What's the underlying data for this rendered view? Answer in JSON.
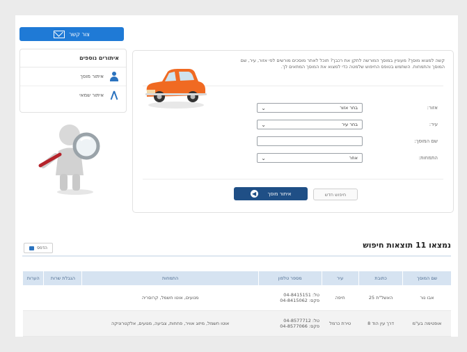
{
  "contact_button": {
    "label": "צור קשר",
    "icon": "envelope-icon"
  },
  "sidebar": {
    "title": "איתורים נוספים",
    "items": [
      {
        "label": "איתור מוסך",
        "icon": "person-icon"
      },
      {
        "label": "איתור שמאי",
        "icon": "compass-icon"
      }
    ]
  },
  "search_panel": {
    "intro": "קשה למצוא מוסך? מעוניין במוסך המורשה לתקן את רכבך? תוכל לאתר מוסכים מורשים לפי אזור, עיר, שם המוסך והתמחות. השתמש בטופס החיפוש שלמטה כדי למצוא את המוסך המתאים לך.",
    "fields": [
      {
        "label": "אזור:",
        "value": "בחר אזור"
      },
      {
        "label": "עיר:",
        "value": "בחר עיר"
      },
      {
        "label": "שם המוסך:",
        "value": ""
      },
      {
        "label": "התמחות:",
        "value": "אחר"
      }
    ],
    "search_button": "איתור מוסך",
    "reset_button": "חיפוש חדש"
  },
  "results": {
    "title": "נמצאו 11 תוצאות חיפוש",
    "print_label": "הדפס",
    "columns": [
      "שם המוסך",
      "כתובת",
      "עיר",
      "מספר טלפון",
      "התמחות",
      "הגבלת שרות",
      "הערות"
    ],
    "rows": [
      {
        "name": "אבו נור",
        "address": "האשל\"ת 25",
        "city": "חיפה",
        "phones": "טל: 04-8415151\nפקס: 04-8415062",
        "specialty": "מנועים, אוטו חשמל, קרוסריה",
        "limit": "",
        "notes": ""
      },
      {
        "name": "אופטימה בע\"מ",
        "address": "דרך עין הוד 8",
        "city": "טירת כרמל",
        "phones": "טל: 04-8577712\nפקס: 04-8577066",
        "specialty": "אוטו חשמל, מיזוג אוויר, פחחות, צביעה, מנועים, אלקטרוניקה",
        "limit": "",
        "notes": ""
      }
    ]
  },
  "colors": {
    "brand_blue": "#1f7ad6",
    "primary_button": "#1f4f86",
    "table_header": "#d6e3f1",
    "car": "#f06a22"
  }
}
